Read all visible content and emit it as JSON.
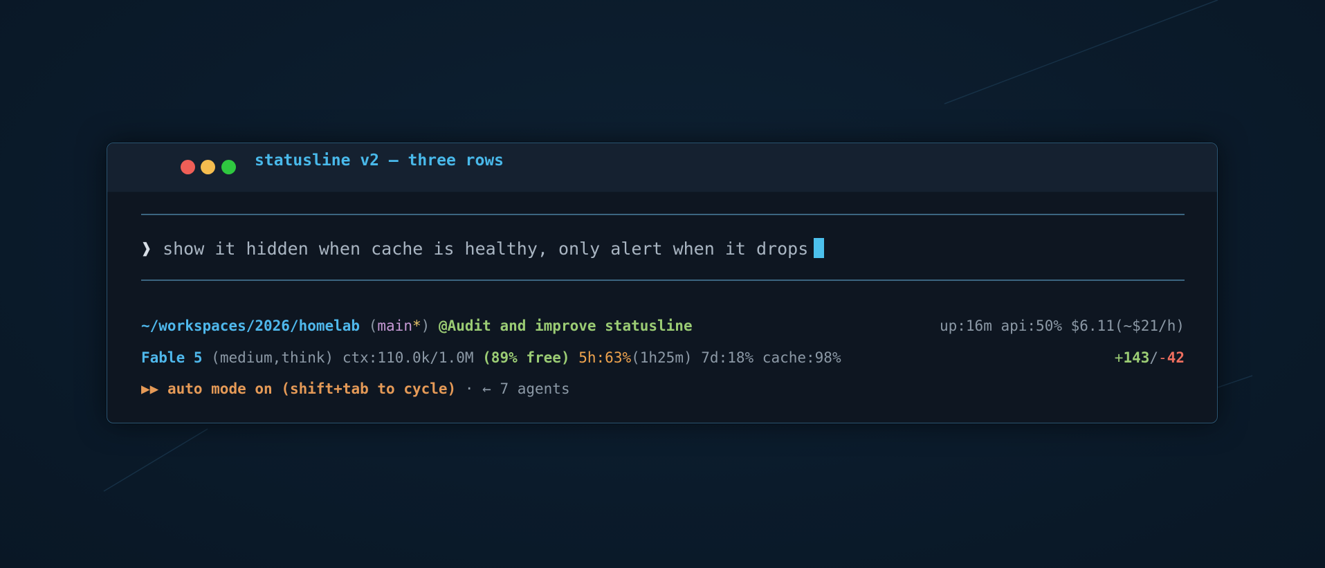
{
  "window": {
    "title": "statusline v2 — three rows"
  },
  "prompt": {
    "glyph": "❱",
    "text": "show it hidden when cache is healthy, only alert when it drops"
  },
  "status": {
    "row1": {
      "path": "~/workspaces/2026/homelab",
      "branch_open": "(",
      "branch": "main",
      "dirty_marker": "*",
      "branch_close": ")",
      "session": "@Audit and improve statusline",
      "right": "up:16m api:50% $6.11(~$21/h)"
    },
    "row2": {
      "model": "Fable 5",
      "mode": "(medium,think)",
      "ctx": "ctx:110.0k/1.0M",
      "ctx_free": "(89% free)",
      "five_hour": "5h:63%",
      "five_hour_reset": "(1h25m)",
      "seven_day": "7d:18%",
      "cache": "cache:98%",
      "added_prefix": "+",
      "added": "143",
      "separator": "/",
      "removed_prefix": "-",
      "removed": "42"
    },
    "row3": {
      "mode_icon": "▶▶",
      "auto_mode": "auto mode on (shift+tab to cycle)",
      "dot": "·",
      "agents": "← 7 agents"
    }
  },
  "colors": {
    "accent_blue": "#4fb8ec",
    "cursor": "#4cc0ec",
    "green": "#9bcc74",
    "orange": "#f0a44e",
    "red": "#ef6f5f",
    "purple": "#c79ad6",
    "muted": "#8c99a6",
    "close_dot": "#ef5f57",
    "minimize_dot": "#f5bd4f",
    "maximize_dot": "#2fc840"
  }
}
